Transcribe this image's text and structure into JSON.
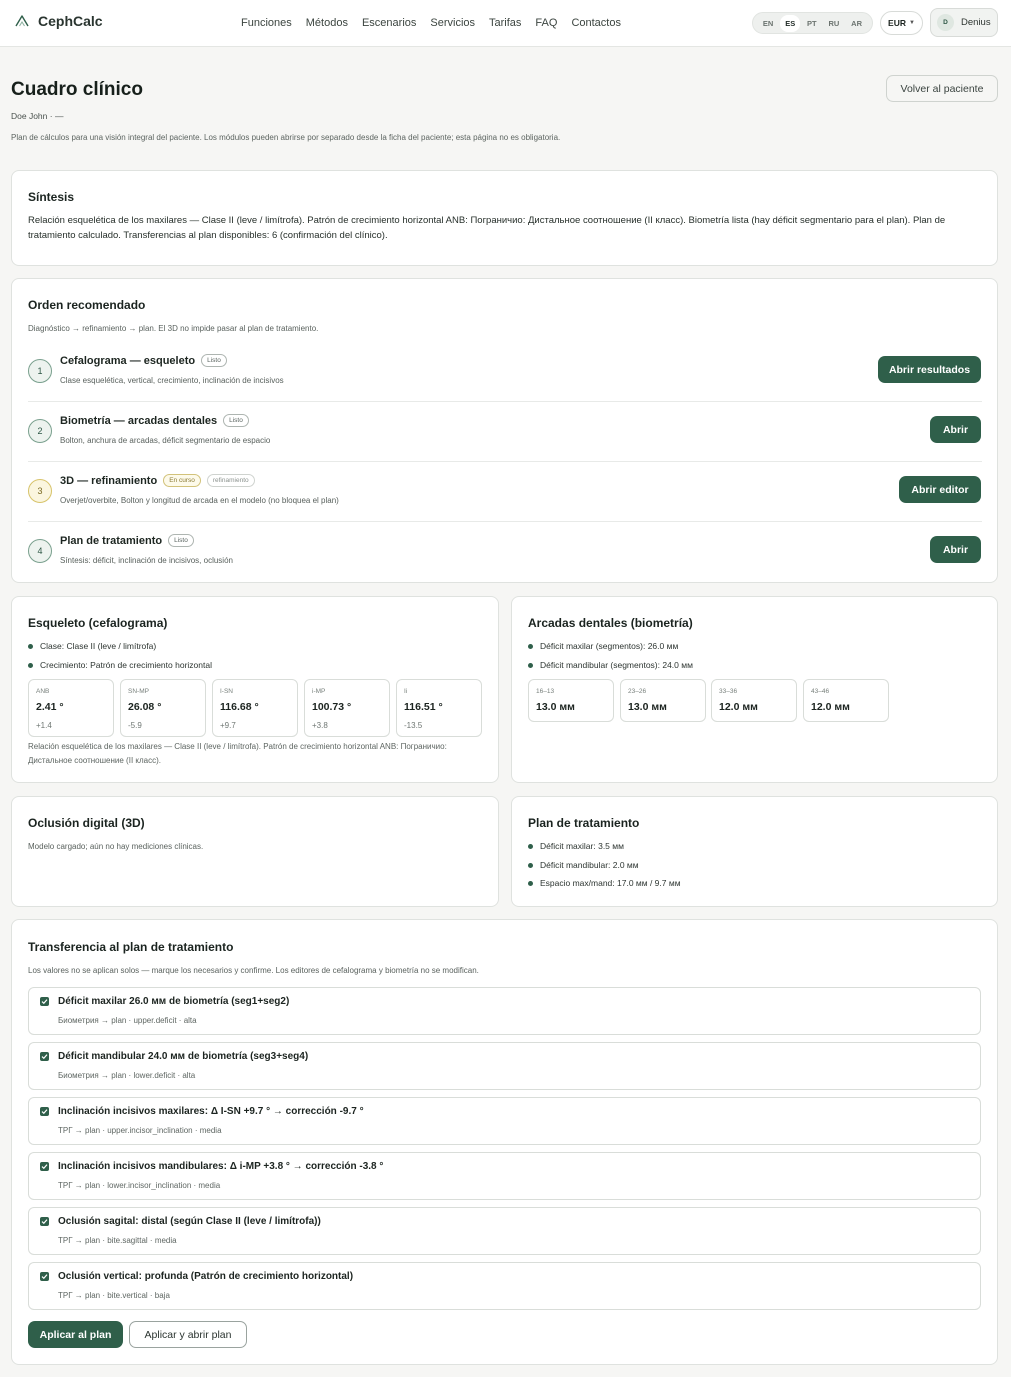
{
  "brand": {
    "name": "CephCalc",
    "logo_icon": "tooth-mountain-icon"
  },
  "nav": [
    "Funciones",
    "Métodos",
    "Escenarios",
    "Servicios",
    "Tarifas",
    "FAQ",
    "Contactos"
  ],
  "languages": [
    "EN",
    "ES",
    "PT",
    "RU",
    "AR"
  ],
  "active_language": "ES",
  "currency": "EUR",
  "user": {
    "initial": "D",
    "name": "Denius"
  },
  "page": {
    "title": "Cuadro clínico",
    "patient": "Doe John · —",
    "description": "Plan de cálculos para una visión integral del paciente. Los módulos pueden abrirse por separado desde la ficha del paciente; esta página no es obligatoria.",
    "back_button": "Volver al paciente"
  },
  "synthesis": {
    "title": "Síntesis",
    "text": "Relación esquelética de los maxilares — Clase II (leve / limítrofa). Patrón de crecimiento horizontal ANB: Пограничио: Дистальное соотношение (II класс). Biometría lista (hay déficit segmentario para el plan). Plan de tratamiento calculado. Transferencias al plan disponibles: 6 (confirmación del clínico)."
  },
  "order": {
    "title": "Orden recomendado",
    "subtitle": "Diagnóstico → refinamiento → plan. El 3D no impide pasar al plan de tratamiento.",
    "steps": [
      {
        "num": "1",
        "title": "Cefalograma — esqueleto",
        "badges": [
          "Listo"
        ],
        "desc": "Clase esquelética, vertical, crecimiento, inclinación de incisivos",
        "button": "Abrir resultados"
      },
      {
        "num": "2",
        "title": "Biometría — arcadas dentales",
        "badges": [
          "Listo"
        ],
        "desc": "Bolton, anchura de arcadas, déficit segmentario de espacio",
        "button": "Abrir"
      },
      {
        "num": "3",
        "title": "3D — refinamiento",
        "badges": [
          "En curso",
          "refinamiento"
        ],
        "desc": "Overjet/overbite, Bolton y longitud de arcada en el modelo (no bloquea el plan)",
        "button": "Abrir editor"
      },
      {
        "num": "4",
        "title": "Plan de tratamiento",
        "badges": [
          "Listo"
        ],
        "desc": "Síntesis: déficit, inclinación de incisivos, oclusión",
        "button": "Abrir"
      }
    ]
  },
  "skeleton": {
    "title": "Esqueleto (cefalograma)",
    "bullets": [
      "Clase: Clase II (leve / limítrofa)",
      "Crecimiento: Patrón de crecimiento horizontal"
    ],
    "metrics": [
      {
        "label": "ANB",
        "value": "2.41 °",
        "dev": "+1.4"
      },
      {
        "label": "SN-MP",
        "value": "26.08 °",
        "dev": "-5.9"
      },
      {
        "label": "I-SN",
        "value": "116.68 °",
        "dev": "+9.7"
      },
      {
        "label": "i-MP",
        "value": "100.73 °",
        "dev": "+3.8"
      },
      {
        "label": "Ii",
        "value": "116.51 °",
        "dev": "-13.5"
      }
    ],
    "note": "Relación esquelética de los maxilares — Clase II (leve / limítrofa). Patrón de crecimiento horizontal ANB: Пограничио: Дистальное соотношение (II класс)."
  },
  "arches": {
    "title": "Arcadas dentales (biometría)",
    "bullets": [
      "Déficit maxilar (segmentos): 26.0 мм",
      "Déficit mandibular (segmentos): 24.0 мм"
    ],
    "segments": [
      {
        "label": "16–13",
        "value": "13.0 мм"
      },
      {
        "label": "23–26",
        "value": "13.0 мм"
      },
      {
        "label": "33–36",
        "value": "12.0 мм"
      },
      {
        "label": "43–46",
        "value": "12.0 мм"
      }
    ]
  },
  "occlusion": {
    "title": "Oclusión digital (3D)",
    "text": "Modelo cargado; aún no hay mediciones clínicas."
  },
  "treatment": {
    "title": "Plan de tratamiento",
    "bullets": [
      "Déficit maxilar: 3.5 мм",
      "Déficit mandibular: 2.0 мм",
      "Espacio max/mand: 17.0 мм / 9.7 мм"
    ]
  },
  "transfer": {
    "title": "Transferencia al plan de tratamiento",
    "subtitle": "Los valores no se aplican solos — marque los necesarios y confirme. Los editores de cefalograma y biometría no se modifican.",
    "items": [
      {
        "title": "Déficit maxilar 26.0 мм de biometría (seg1+seg2)",
        "meta": "Биометрия → plan · upper.deficit · alta",
        "checked": true
      },
      {
        "title": "Déficit mandibular 24.0 мм de biometría (seg3+seg4)",
        "meta": "Биометрия → plan · lower.deficit · alta",
        "checked": true
      },
      {
        "title": "Inclinación incisivos maxilares: Δ I-SN +9.7 ° → corrección -9.7 °",
        "meta": "ТРГ → plan · upper.incisor_inclination · media",
        "checked": true
      },
      {
        "title": "Inclinación incisivos mandibulares: Δ i-MP +3.8 ° → corrección -3.8 °",
        "meta": "ТРГ → plan · lower.incisor_inclination · media",
        "checked": true
      },
      {
        "title": "Oclusión sagital: distal (según Clase II (leve / limítrofa))",
        "meta": "ТРГ → plan · bite.sagittal · media",
        "checked": true
      },
      {
        "title": "Oclusión vertical: profunda (Patrón de crecimiento horizontal)",
        "meta": "ТРГ → plan · bite.vertical · baja",
        "checked": true
      }
    ],
    "apply_button": "Aplicar al plan",
    "apply_open_button": "Aplicar y abrir plan"
  }
}
